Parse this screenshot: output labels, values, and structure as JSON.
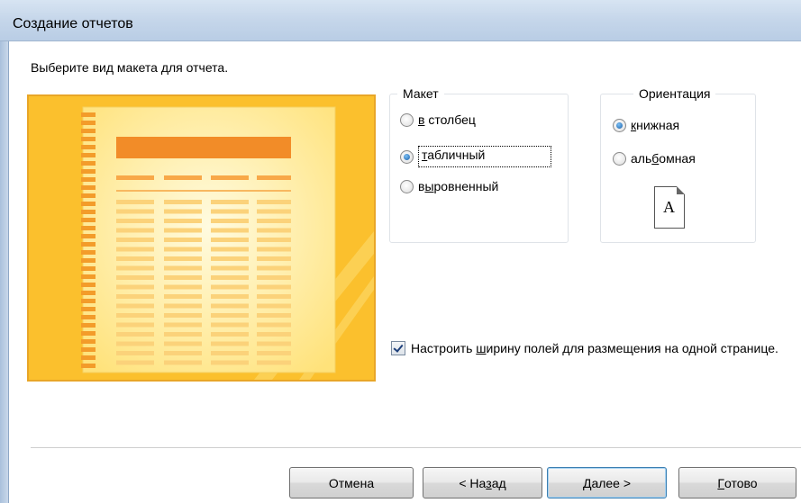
{
  "window": {
    "title": "Создание отчетов"
  },
  "instruction": "Выберите вид макета для отчета.",
  "layout_group": {
    "legend": "Макет",
    "options": [
      {
        "pre": "",
        "accel": "в",
        "post": " столбец",
        "checked": false
      },
      {
        "pre": "",
        "accel": "т",
        "post": "абличный",
        "checked": true
      },
      {
        "pre": "в",
        "accel": "ы",
        "post": "ровненный",
        "checked": false
      }
    ]
  },
  "orientation_group": {
    "legend": "Ориентация",
    "options": [
      {
        "pre": "",
        "accel": "к",
        "post": "нижная",
        "checked": true
      },
      {
        "pre": "аль",
        "accel": "б",
        "post": "омная",
        "checked": false
      }
    ],
    "page_icon_letter": "A"
  },
  "fit_fields": {
    "checked": true,
    "pre": "Настроить ",
    "accel": "ш",
    "post": "ирину полей для размещения на одной странице."
  },
  "buttons": {
    "cancel": {
      "pre": "Отмена",
      "accel": "",
      "post": ""
    },
    "back": {
      "pre": "< На",
      "accel": "з",
      "post": "ад"
    },
    "next": {
      "pre": "",
      "accel": "Д",
      "post": "алее >"
    },
    "finish": {
      "pre": "",
      "accel": "Г",
      "post": "отово"
    }
  },
  "colors": {
    "titlebar": "#c5d6ea",
    "preview_bg": "#fbc02d",
    "preview_page": "#fff3b8",
    "preview_header_bar": "#f28c28",
    "default_button_border": "#3c7fb1"
  }
}
